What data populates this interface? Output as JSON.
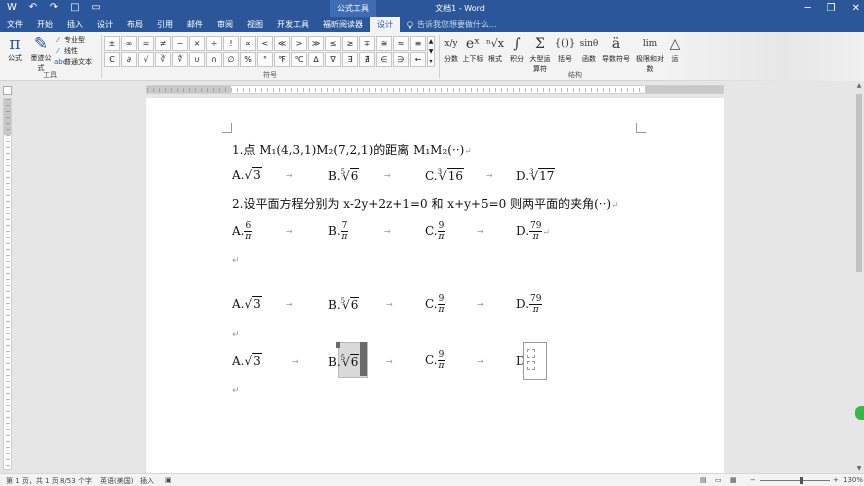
{
  "titlebar": {
    "context_group": "公式工具",
    "document_title": "文档1 - Word",
    "window_controls": [
      "─",
      "❐",
      "✕"
    ]
  },
  "quick_access": [
    "W",
    "↶",
    "↷",
    "□",
    "▭"
  ],
  "tabs": [
    "文件",
    "开始",
    "插入",
    "设计",
    "布局",
    "引用",
    "邮件",
    "审阅",
    "视图",
    "开发工具",
    "福昕阅读器",
    "设计"
  ],
  "tell_me": "告诉我您想要做什么...",
  "ribbon": {
    "tools_group": {
      "label": "工具",
      "equation_label": "公式",
      "ink_equation_label": "墨迹公式",
      "professional": "专业型",
      "linear": "线性",
      "normal_text": "普通文本",
      "abc_prefix": "abc"
    },
    "symbols_group": {
      "label": "符号",
      "row1": [
        "±",
        "∞",
        "=",
        "≠",
        "~",
        "×",
        "÷",
        "!",
        "∝",
        "<",
        "≪",
        ">",
        "≫",
        "≤",
        "≥",
        "∓",
        "≅",
        "≈",
        "≡"
      ],
      "row2": [
        "C",
        "∂",
        "√",
        "∛",
        "∜",
        "∪",
        "∩",
        "∅",
        "%",
        "°",
        "℉",
        "℃",
        "∆",
        "∇",
        "∃",
        "∄",
        "∈",
        "∋",
        "←"
      ],
      "row3": [
        "↑"
      ]
    },
    "structures_group": {
      "label": "结构",
      "items": [
        {
          "glyph": "x/y",
          "label": "分数"
        },
        {
          "glyph": "eˣ",
          "label": "上下标"
        },
        {
          "glyph": "ⁿ√x",
          "label": "根式"
        },
        {
          "glyph": "∫",
          "label": "积分"
        },
        {
          "glyph": "Σ",
          "label": "大型运算符"
        },
        {
          "glyph": "{()}",
          "label": "括号"
        },
        {
          "glyph": "sinθ",
          "label": "函数"
        },
        {
          "glyph": "ä",
          "label": "导数符号"
        },
        {
          "glyph": "lim",
          "label": "极限和对数"
        },
        {
          "glyph": "△",
          "label": "运"
        }
      ],
      "large_op_sub": "运算符 ▾"
    }
  },
  "document": {
    "q1": {
      "stem": "1.点 M₁(4,3,1)M₂(7,2,1)的距离 M₁M₂(··)",
      "options": [
        {
          "letter": "A.",
          "index": "",
          "radicand": "3"
        },
        {
          "letter": "B.",
          "index": "5",
          "radicand": "6"
        },
        {
          "letter": "C.",
          "index": "3",
          "radicand": "16"
        },
        {
          "letter": "D.",
          "index": "3",
          "radicand": "17"
        }
      ]
    },
    "q2": {
      "stem": "2.设平面方程分别为 x-2y+2z+1=0 和 x+y+5=0 则两平面的夹角(··)",
      "options": [
        {
          "letter": "A.",
          "num": "6",
          "den": "π"
        },
        {
          "letter": "B.",
          "num": "7",
          "den": "π"
        },
        {
          "letter": "C.",
          "num": "9",
          "den": "π"
        },
        {
          "letter": "D.",
          "num": "79",
          "den": "π"
        }
      ]
    },
    "row3": {
      "a": {
        "letter": "A.",
        "radicand": "3"
      },
      "b": {
        "letter": "B.",
        "index": "5",
        "radicand": "6"
      },
      "c": {
        "letter": "C.",
        "num": "9",
        "den": "π"
      },
      "d": {
        "letter": "D.",
        "num": "79",
        "den": "π"
      }
    },
    "row4": {
      "a": {
        "letter": "A.",
        "radicand": "3"
      },
      "b": {
        "letter": "B.",
        "index": "5",
        "radicand": "6"
      },
      "c": {
        "letter": "C.",
        "num": "9",
        "den": "π"
      },
      "d": {
        "letter": "D."
      }
    },
    "para_mark": "↵",
    "tab_mark": "→"
  },
  "statusbar": {
    "page": "第 1 页，共 1 页",
    "words": "8/53 个字",
    "language": "英语(美国)",
    "mode": "插入",
    "zoom": "130%"
  },
  "colors": {
    "accent": "#2b579a",
    "ribbon_bg": "#f3f3f3",
    "page_bg": "#ffffff",
    "canvas_bg": "#e6e6e6"
  }
}
